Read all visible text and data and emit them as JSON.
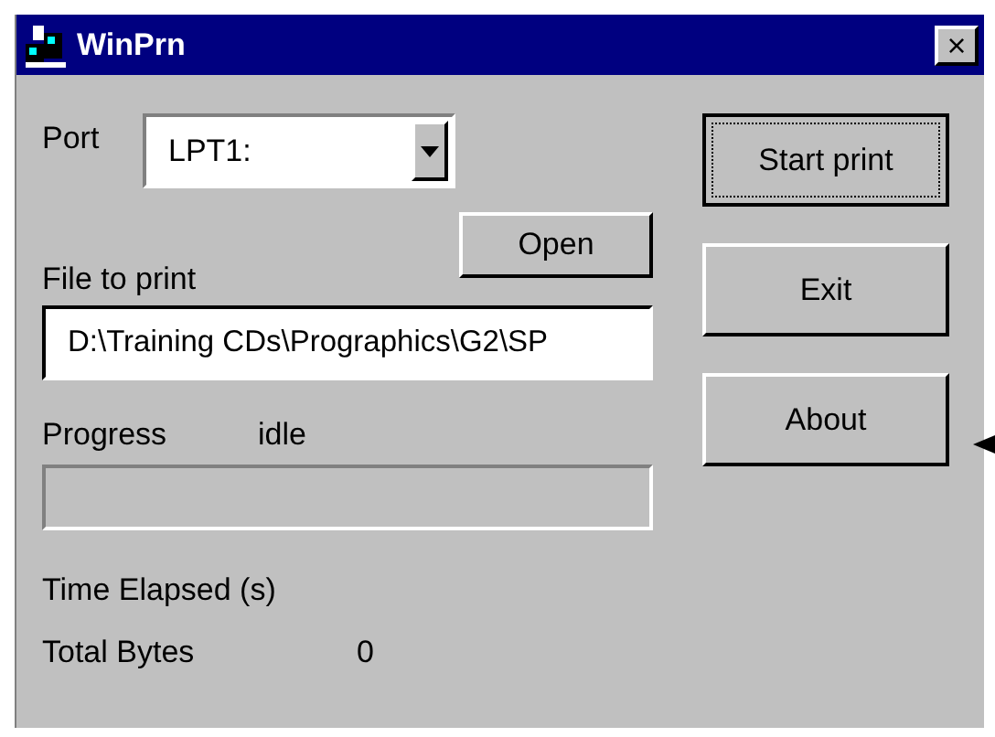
{
  "window": {
    "title": "WinPrn",
    "close": "×"
  },
  "port": {
    "label": "Port",
    "value": "LPT1:"
  },
  "open_button": "Open",
  "file": {
    "label": "File to print",
    "value": "D:\\Training CDs\\Prographics\\G2\\SP"
  },
  "progress": {
    "label": "Progress",
    "status": "idle"
  },
  "time_elapsed": {
    "label": "Time Elapsed (s)"
  },
  "total_bytes": {
    "label": "Total Bytes",
    "value": "0"
  },
  "buttons": [
    {
      "label": "Start print",
      "focused": true
    },
    {
      "label": "Exit",
      "focused": false
    },
    {
      "label": "About",
      "focused": false
    }
  ]
}
